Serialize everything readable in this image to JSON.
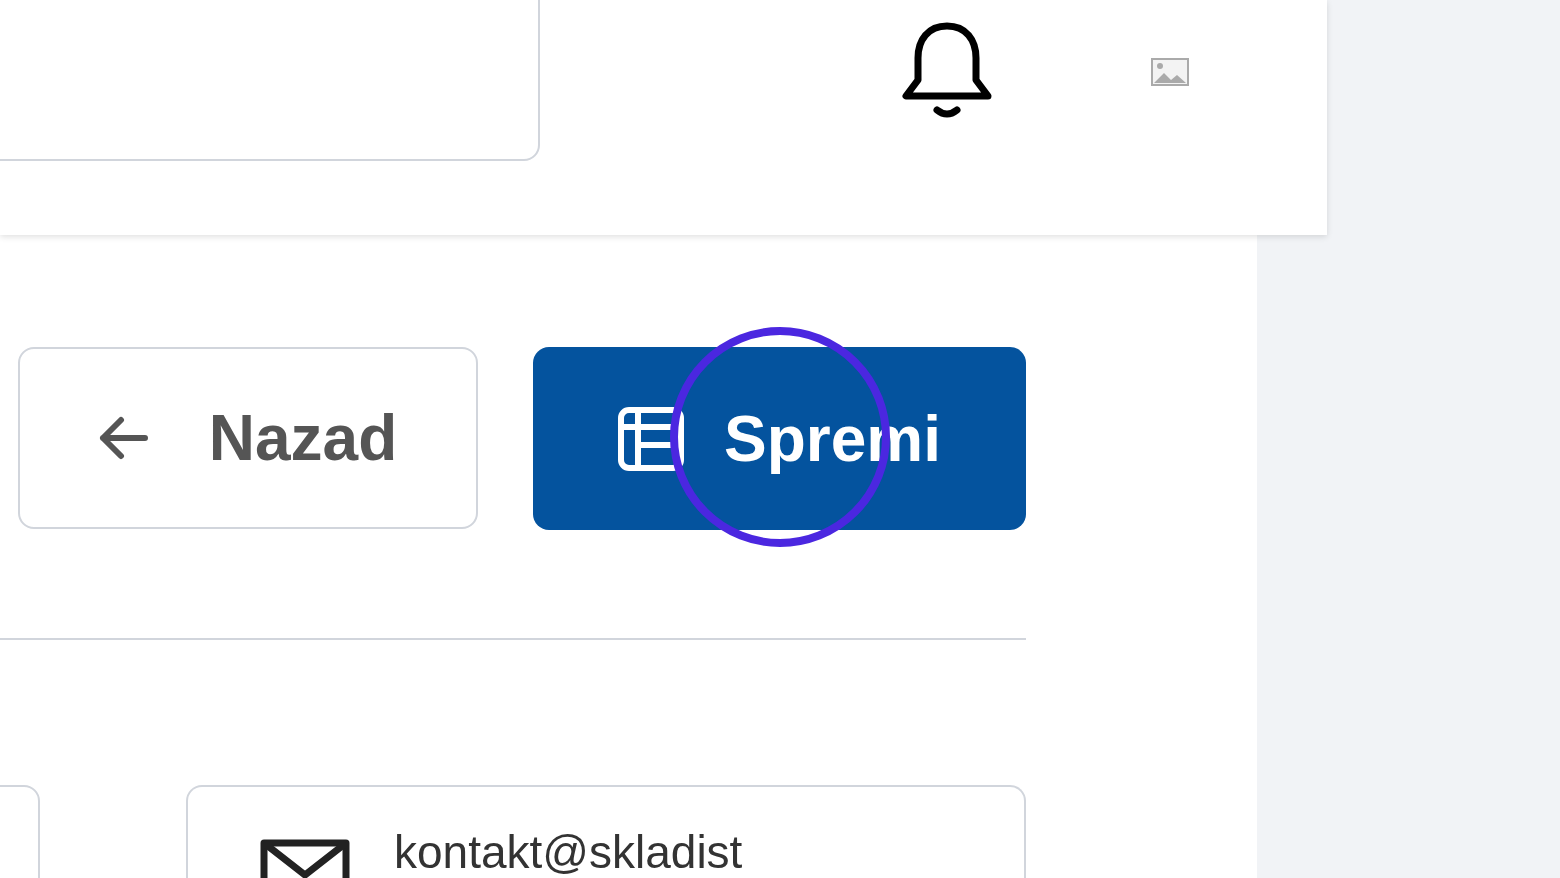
{
  "buttons": [
    {
      "kind": "back",
      "label": "Nazad"
    },
    {
      "kind": "save",
      "label": "Spremi"
    }
  ],
  "click_marker": {
    "shown": true
  },
  "email_field": {
    "value": "kontakt@skladist"
  }
}
